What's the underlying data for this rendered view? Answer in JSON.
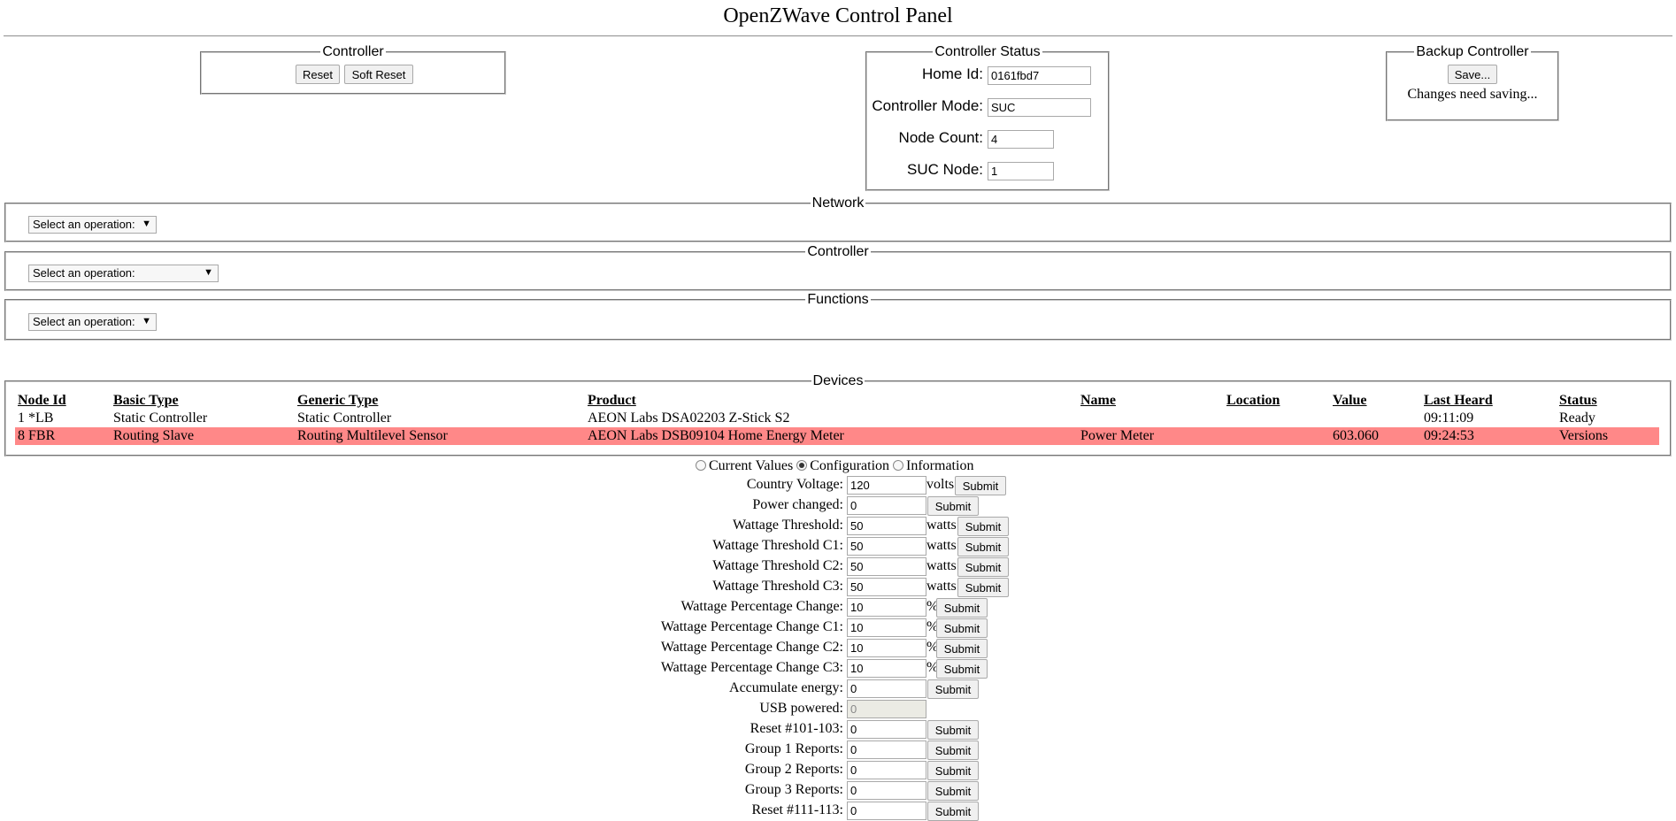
{
  "title": "OpenZWave Control Panel",
  "controller": {
    "legend": "Controller",
    "reset": "Reset",
    "soft_reset": "Soft Reset"
  },
  "status": {
    "legend": "Controller Status",
    "home_id_label": "Home Id:",
    "home_id": "0161fbd7",
    "mode_label": "Controller Mode:",
    "mode": "SUC",
    "node_count_label": "Node Count:",
    "node_count": "4",
    "suc_node_label": "SUC Node:",
    "suc_node": "1"
  },
  "backup": {
    "legend": "Backup Controller",
    "save": "Save...",
    "message": "Changes need saving..."
  },
  "network": {
    "legend": "Network",
    "select": "Select an operation:"
  },
  "controller_ops": {
    "legend": "Controller",
    "select": "Select an operation:"
  },
  "functions": {
    "legend": "Functions",
    "select": "Select an operation:"
  },
  "arrow_glyph": "▼",
  "devices": {
    "legend": "Devices",
    "columns": [
      "Node Id",
      "Basic Type",
      "Generic Type",
      "Product",
      "Name",
      "Location",
      "Value",
      "Last Heard",
      "Status"
    ],
    "rows": [
      [
        "1 *LB",
        "Static Controller",
        "Static Controller",
        "AEON Labs DSA02203 Z-Stick S2",
        "",
        "",
        "",
        "09:11:09",
        "Ready"
      ],
      [
        "8 FBR",
        "Routing Slave",
        "Routing Multilevel Sensor",
        "AEON Labs DSB09104 Home Energy Meter",
        "Power Meter",
        "",
        "603.060",
        "09:24:53",
        "Versions"
      ]
    ],
    "selected_row_color": "#ff8888"
  },
  "view_tabs": {
    "current": "Current Values",
    "config": "Configuration",
    "info": "Information",
    "selected": "Configuration"
  },
  "config": [
    {
      "label": "Country Voltage:",
      "value": "120",
      "unit": "volts",
      "button": "Submit"
    },
    {
      "label": "Power changed:",
      "value": "0",
      "unit": "",
      "button": "Submit"
    },
    {
      "label": "Wattage Threshold:",
      "value": "50",
      "unit": "watts",
      "button": "Submit"
    },
    {
      "label": "Wattage Threshold C1:",
      "value": "50",
      "unit": "watts",
      "button": "Submit"
    },
    {
      "label": "Wattage Threshold C2:",
      "value": "50",
      "unit": "watts",
      "button": "Submit"
    },
    {
      "label": "Wattage Threshold C3:",
      "value": "50",
      "unit": "watts",
      "button": "Submit"
    },
    {
      "label": "Wattage Percentage Change:",
      "value": "10",
      "unit": "%",
      "button": "Submit"
    },
    {
      "label": "Wattage Percentage Change C1:",
      "value": "10",
      "unit": "%",
      "button": "Submit"
    },
    {
      "label": "Wattage Percentage Change C2:",
      "value": "10",
      "unit": "%",
      "button": "Submit"
    },
    {
      "label": "Wattage Percentage Change C3:",
      "value": "10",
      "unit": "%",
      "button": "Submit"
    },
    {
      "label": "Accumulate energy:",
      "value": "0",
      "unit": "",
      "button": "Submit"
    },
    {
      "label": "USB powered:",
      "value": "0",
      "unit": "",
      "button": "",
      "disabled": true
    },
    {
      "label": "Reset #101-103:",
      "value": "0",
      "unit": "",
      "button": "Submit"
    },
    {
      "label": "Group 1 Reports:",
      "value": "0",
      "unit": "",
      "button": "Submit"
    },
    {
      "label": "Group 2 Reports:",
      "value": "0",
      "unit": "",
      "button": "Submit"
    },
    {
      "label": "Group 3 Reports:",
      "value": "0",
      "unit": "",
      "button": "Submit"
    },
    {
      "label": "Reset #111-113:",
      "value": "0",
      "unit": "",
      "button": "Submit"
    }
  ]
}
